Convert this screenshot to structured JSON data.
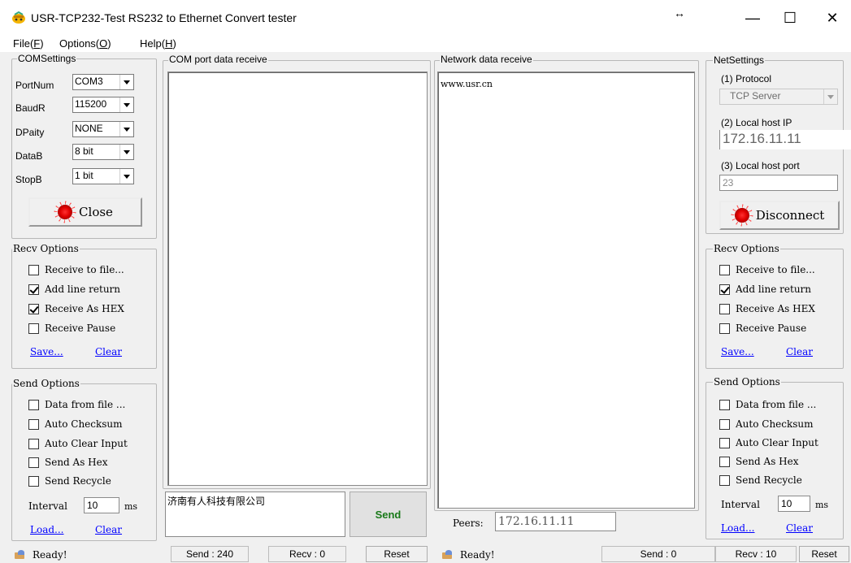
{
  "window": {
    "title": "USR-TCP232-Test  RS232 to Ethernet Convert tester",
    "resize_symbol": "↔",
    "minimize_symbol": "—",
    "maximize_symbol": "☐",
    "close_symbol": "✕"
  },
  "menu": {
    "file": "File(",
    "file_key": "F",
    "options": "Options(",
    "options_key": "O",
    "help": "Help(",
    "help_key": "H",
    "close_paren": ")"
  },
  "com_settings": {
    "title": "COMSettings",
    "port_label": "PortNum",
    "port_value": "COM3",
    "baud_label": "BaudR",
    "baud_value": "115200",
    "parity_label": "DPaity",
    "parity_value": "NONE",
    "databits_label": "DataB",
    "databits_value": "8 bit",
    "stopbits_label": "StopB",
    "stopbits_value": "1 bit",
    "close_button": "Close"
  },
  "left_recv": {
    "title": "Recv Options",
    "receive_to_file": "Receive to file...",
    "add_line_return": "Add line return",
    "receive_as_hex": "Receive As HEX",
    "receive_pause": "Receive Pause",
    "save": "Save...",
    "clear": "Clear"
  },
  "left_send": {
    "title": "Send Options",
    "data_from_file": "Data from file ...",
    "auto_checksum": "Auto Checksum",
    "auto_clear_input": "Auto Clear Input",
    "send_as_hex": "Send As Hex",
    "send_recycle": "Send Recycle",
    "interval_label": "Interval",
    "interval_value": "10",
    "ms": "ms",
    "load": "Load...",
    "clear": "Clear"
  },
  "com_receive": {
    "title": "COM port data receive",
    "send_text": "济南有人科技有限公司",
    "send_button": "Send"
  },
  "net_receive": {
    "title": "Network data receive",
    "content": "www.usr.cn",
    "peers_label": "Peers:",
    "peers_value": "172.16.11.11"
  },
  "net_settings": {
    "title": "NetSettings",
    "protocol_label": "(1) Protocol",
    "protocol_value": "TCP Server",
    "local_ip_label": "(2) Local host IP",
    "local_ip_value": "172.16.11.11",
    "local_port_label": "(3) Local host port",
    "local_port_value": "23",
    "disconnect_button": "Disconnect"
  },
  "right_recv": {
    "title": "Recv Options",
    "receive_to_file": "Receive to file...",
    "add_line_return": "Add line return",
    "receive_as_hex": "Receive As HEX",
    "receive_pause": "Receive Pause",
    "save": "Save...",
    "clear": "Clear"
  },
  "right_send": {
    "title": "Send Options",
    "data_from_file": "Data from file ...",
    "auto_checksum": "Auto Checksum",
    "auto_clear_input": "Auto Clear Input",
    "send_as_hex": "Send As Hex",
    "send_recycle": "Send Recycle",
    "interval_label": "Interval",
    "interval_value": "10",
    "ms": "ms",
    "load": "Load...",
    "clear": "Clear"
  },
  "status_left": {
    "ready": "Ready!",
    "send": "Send : 240",
    "recv": "Recv : 0",
    "reset": "Reset"
  },
  "status_right": {
    "ready": "Ready!",
    "send": "Send : 0",
    "recv": "Recv : 10",
    "reset": "Reset"
  }
}
